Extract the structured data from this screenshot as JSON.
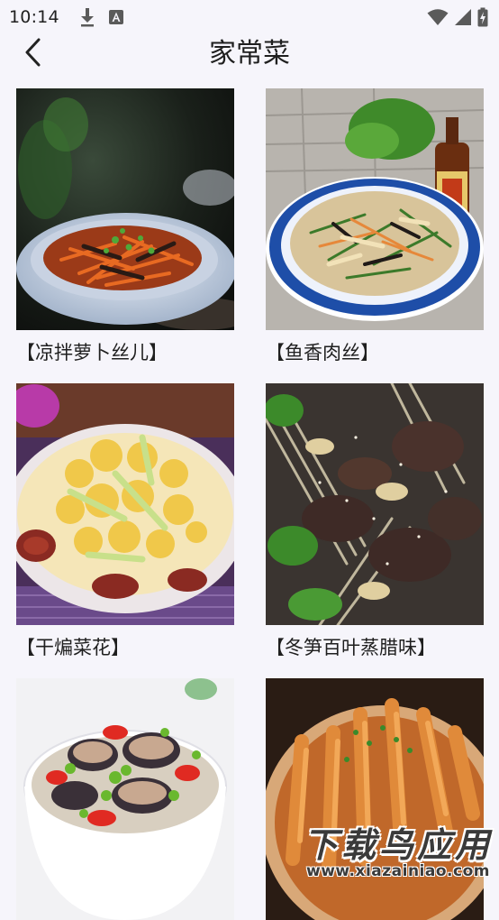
{
  "status_bar": {
    "time": "10:14",
    "icons": [
      "download-icon",
      "a-badge-icon",
      "wifi-icon",
      "signal-icon",
      "battery-icon"
    ]
  },
  "header": {
    "title": "家常菜",
    "back_icon": "chevron-left-icon"
  },
  "recipes": [
    {
      "label": "【凉拌萝卜丝儿】"
    },
    {
      "label": "【鱼香肉丝】"
    },
    {
      "label": "【干煸菜花】"
    },
    {
      "label": "【冬笋百叶蒸腊味】"
    },
    {
      "label": ""
    },
    {
      "label": ""
    }
  ],
  "watermark": {
    "main": "下载鸟应用",
    "sub": "www.xiazainiao.com"
  },
  "colors": {
    "background": "#f6f5fb",
    "text": "#1f1f1f"
  }
}
